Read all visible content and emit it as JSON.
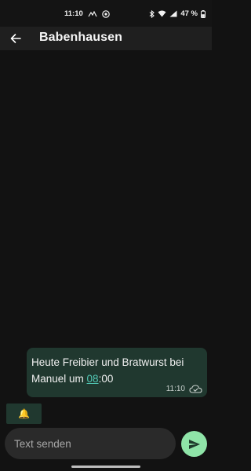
{
  "status_bar": {
    "time": "11:10",
    "battery_percent": "47 %",
    "icons": [
      "signal-strength-icon",
      "vpn-icon",
      "bluetooth-icon",
      "wifi-icon",
      "cell-signal-icon",
      "battery-icon"
    ]
  },
  "app_bar": {
    "title": "Babenhausen",
    "back_icon": "arrow-left-icon"
  },
  "chat": {
    "messages": [
      {
        "text_before_link": "Heute Freibier und Bratwurst bei Manuel um ",
        "link_text": "08",
        "text_after_link": ":00",
        "time": "11:10",
        "status_icon": "cloud-check-icon"
      }
    ],
    "notify_chip": {
      "icon": "bell-icon",
      "glyph": "🔔"
    }
  },
  "composer": {
    "placeholder": "Text senden",
    "value": "",
    "send_icon": "send-icon"
  },
  "colors": {
    "background": "#121212",
    "app_bar": "#1f1f1f",
    "bubble": "#20382f",
    "link": "#52c7b4",
    "send_button": "#8fe4a8",
    "input_background": "#2a2a2a"
  }
}
